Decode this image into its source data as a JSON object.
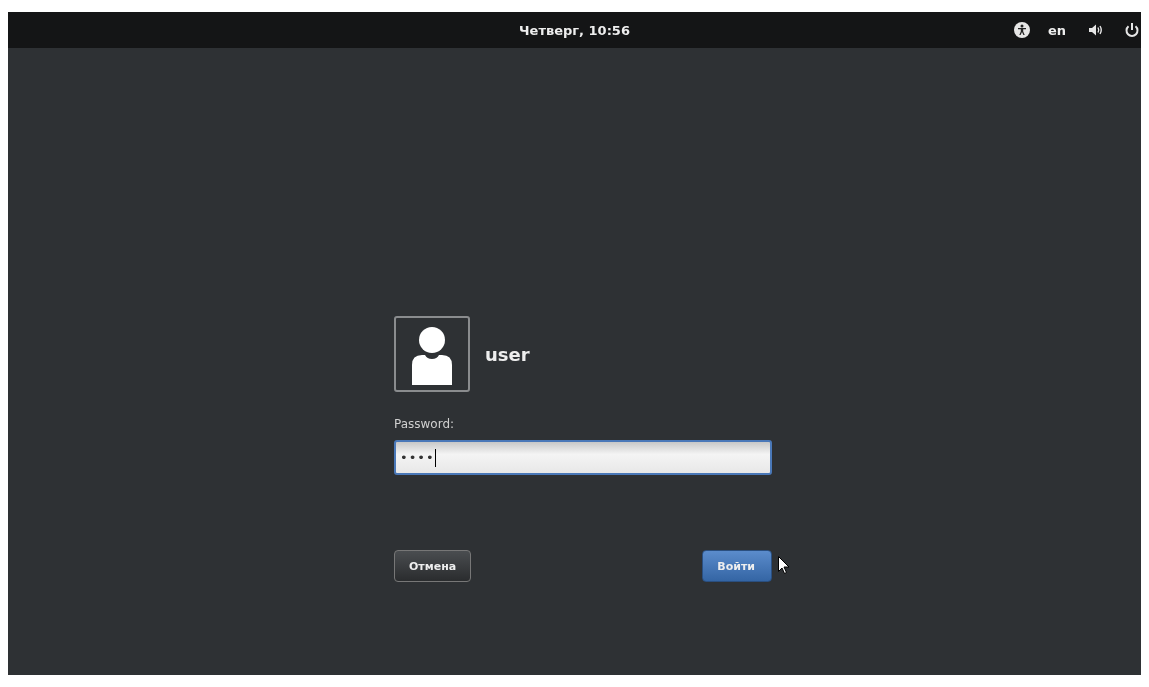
{
  "top_bar": {
    "clock": "Четверг, 10:56",
    "keyboard_layout": "en"
  },
  "login": {
    "user_name": "user",
    "password_label": "Password:",
    "password_value": "••••"
  },
  "buttons": [
    {
      "kind": "cancel",
      "label": "Отмена"
    },
    {
      "kind": "default",
      "label": "Войти"
    }
  ]
}
